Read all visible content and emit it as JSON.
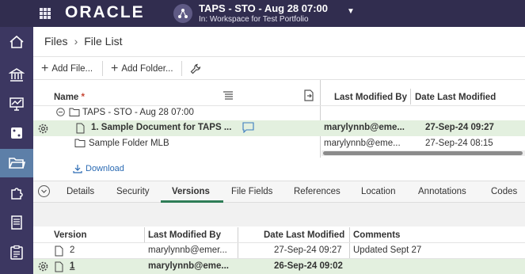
{
  "app": {
    "brand": "ORACLE",
    "workspace_title": "TAPS - STO - Aug 28 07:00",
    "workspace_subtitle": "In: Workspace for Test Portfolio"
  },
  "nav": {
    "items": [
      "home-icon",
      "bank-icon",
      "chart-icon",
      "dice-icon",
      "folder-icon",
      "puzzle-icon",
      "document-icon",
      "report-icon"
    ],
    "active": "folder-icon"
  },
  "breadcrumb": {
    "root": "Files",
    "current": "File List"
  },
  "toolbar": {
    "add_file": "Add File...",
    "add_folder": "Add Folder..."
  },
  "files_table": {
    "headers": {
      "name": "Name",
      "required_mark": "*",
      "modified_by": "Last Modified By",
      "date_modified": "Date Last Modified"
    },
    "rows": [
      {
        "name": "TAPS - STO - Aug 28 07:00",
        "type": "folder-open",
        "modified_by": "",
        "date": ""
      },
      {
        "name": "1. Sample Document for TAPS ...",
        "type": "document",
        "modified_by": "marylynnb@eme...",
        "date": "27-Sep-24 09:27",
        "selected": true
      },
      {
        "name": "Sample Folder MLB",
        "type": "folder",
        "modified_by": "marylynnb@eme...",
        "date": "27-Sep-24 08:15"
      }
    ],
    "download_label": "Download"
  },
  "tabs": {
    "items": [
      "Details",
      "Security",
      "Versions",
      "File Fields",
      "References",
      "Location",
      "Annotations",
      "Codes"
    ],
    "active": "Versions"
  },
  "versions_table": {
    "headers": {
      "version": "Version",
      "modified_by": "Last Modified By",
      "date_modified": "Date Last Modified",
      "comments": "Comments"
    },
    "rows": [
      {
        "version": "2",
        "modified_by": "marylynnb@emer...",
        "date": "27-Sep-24 09:27",
        "comment": "Updated Sept 27"
      },
      {
        "version": "1",
        "modified_by": "marylynnb@eme...",
        "date": "26-Sep-24 09:02",
        "comment": "",
        "selected": true
      }
    ]
  },
  "colors": {
    "topbar": "#312d4f",
    "nav": "#3c3761",
    "nav_active": "#5d7fa8",
    "selected_row": "#e3f0df",
    "accent_green": "#2f7d57",
    "link_blue": "#2a6ab3"
  }
}
